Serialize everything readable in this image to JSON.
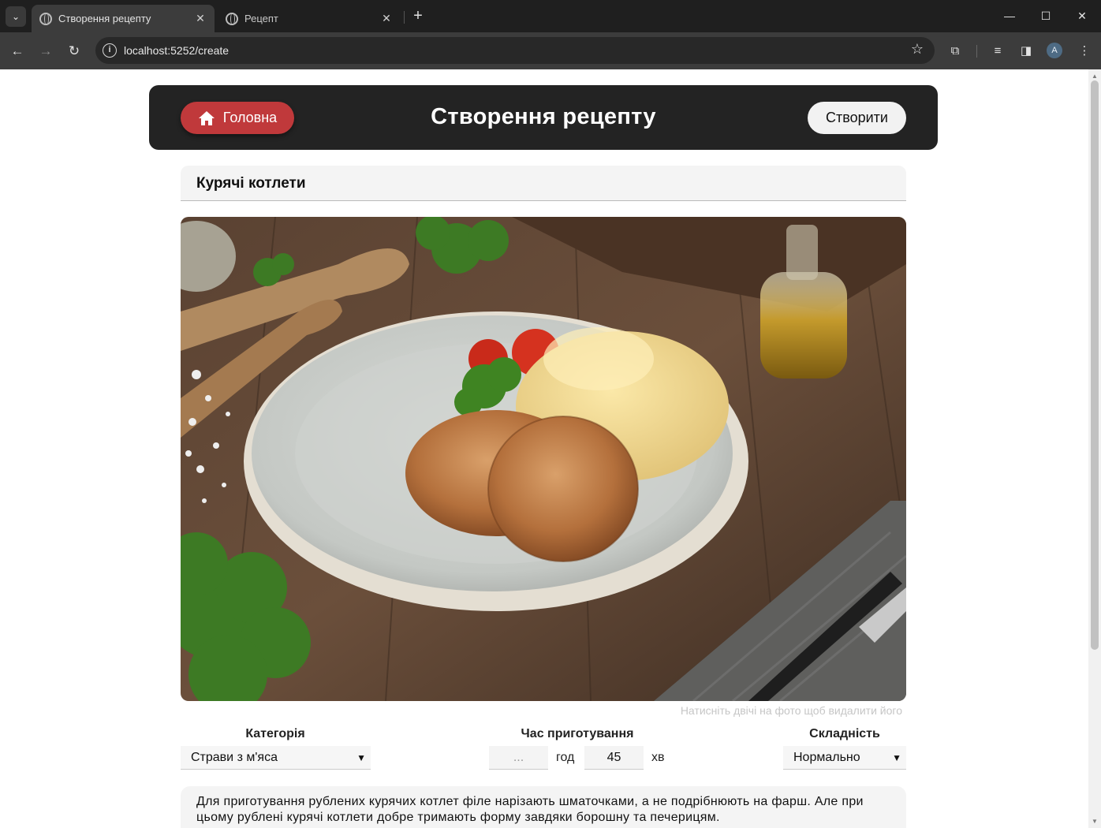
{
  "browser": {
    "tabs": [
      {
        "title": "Створення рецепту",
        "active": true
      },
      {
        "title": "Рецепт",
        "active": false
      }
    ],
    "url": "localhost:5252/create",
    "profile_initial": "A"
  },
  "header": {
    "home_label": "Головна",
    "title": "Створення рецепту",
    "create_label": "Створити"
  },
  "recipe": {
    "name": "Курячі котлети",
    "photo_hint": "Натисніть двічі на фото щоб видалити його",
    "category": {
      "label": "Категорія",
      "value": "Страви з м'яса"
    },
    "cook_time": {
      "label": "Час приготування",
      "hours_placeholder": "...",
      "hours_unit": "год",
      "minutes_value": "45",
      "minutes_unit": "хв"
    },
    "difficulty": {
      "label": "Складність",
      "value": "Нормально"
    },
    "description": "Для приготування рублених курячих котлет філе нарізають шматочками, а не подрібнюють на фарш. Але при цьому рублені курячі котлети добре тримають форму завдяки борошну та печерицям."
  },
  "colors": {
    "header_bg": "#232323",
    "home_button": "#c0393b",
    "field_bg": "#f4f4f4"
  }
}
